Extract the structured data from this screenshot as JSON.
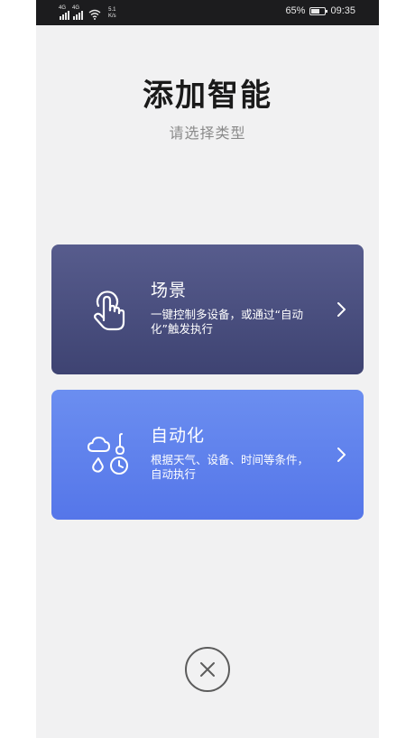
{
  "status_bar": {
    "network_left": "4G",
    "network_right": "4G",
    "speed_value": "5.1",
    "speed_unit": "K/s",
    "battery_percent": "65%",
    "battery_level": 0.65,
    "time": "09:35"
  },
  "header": {
    "title": "添加智能",
    "subtitle": "请选择类型"
  },
  "cards": [
    {
      "title": "场景",
      "description": "一键控制多设备，或通过“自动化”触发执行",
      "icon": "tap-hand-icon",
      "gradient_top": "#575c8d",
      "gradient_bottom": "#3e4372"
    },
    {
      "title": "自动化",
      "description": "根据天气、设备、时间等条件，自动执行",
      "icon": "weather-clock-icon",
      "gradient_top": "#6b8ef0",
      "gradient_bottom": "#5576e9"
    }
  ],
  "close": {
    "icon": "close-icon"
  }
}
